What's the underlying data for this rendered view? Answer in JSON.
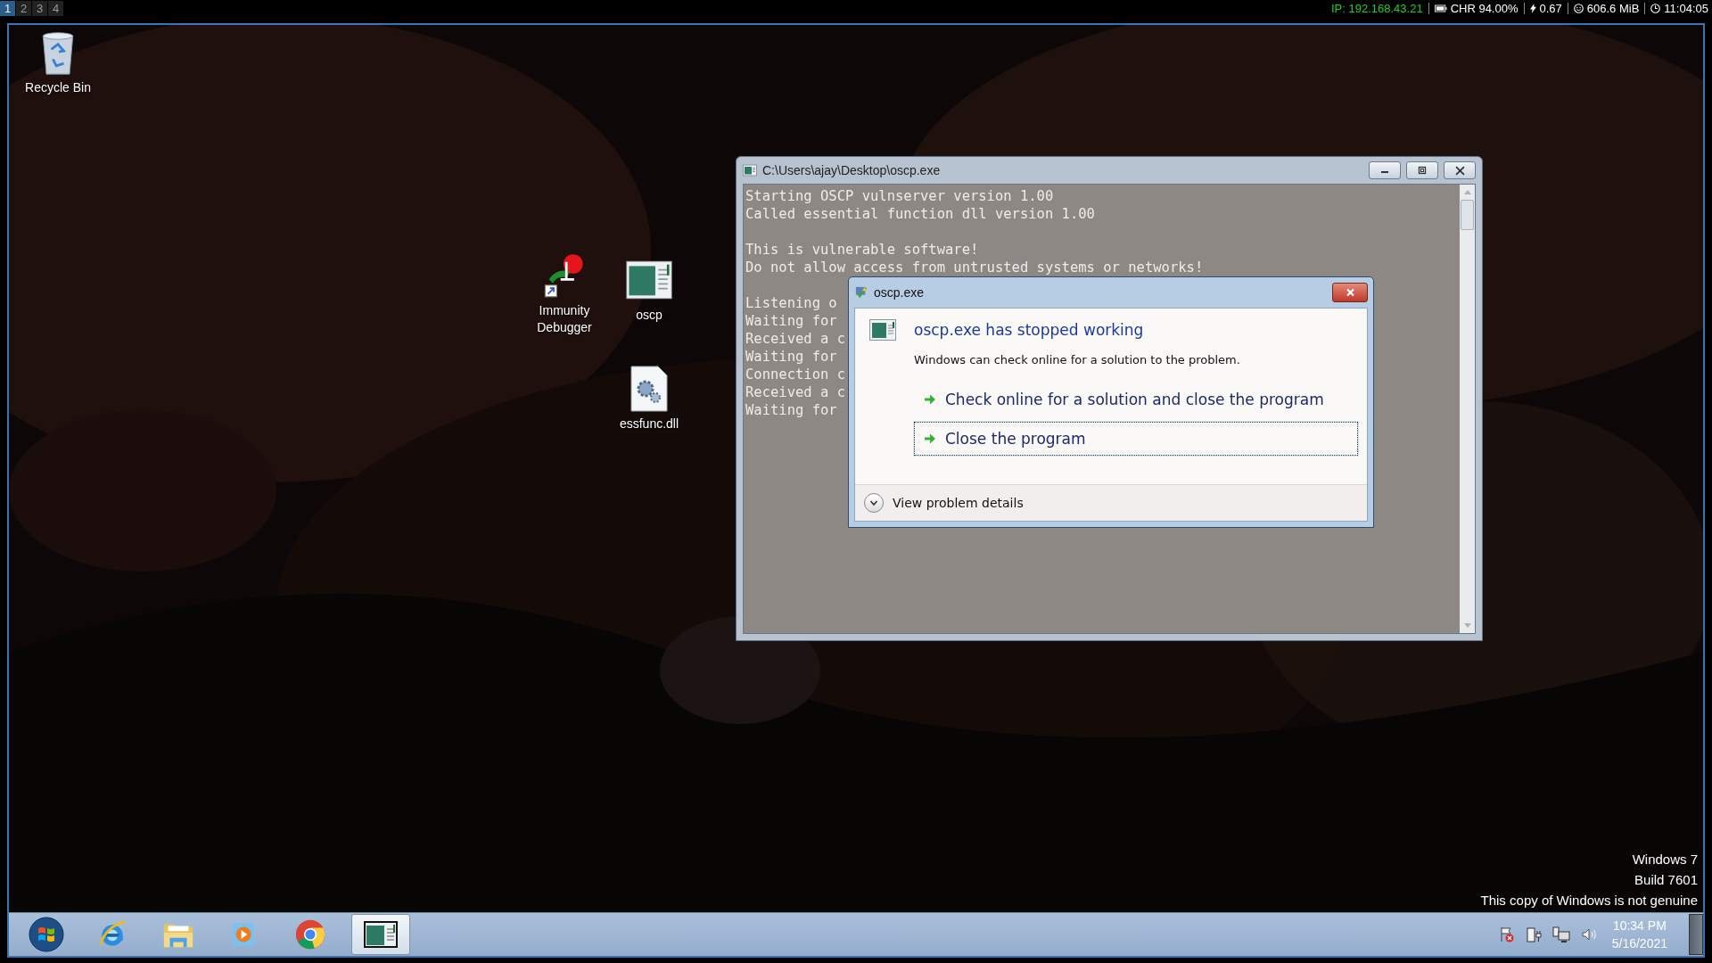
{
  "workspaces": [
    {
      "label": "1",
      "selected": true
    },
    {
      "label": "2",
      "selected": false
    },
    {
      "label": "3",
      "selected": false
    },
    {
      "label": "4",
      "selected": false
    }
  ],
  "status_bar": {
    "ip": "IP: 192.168.43.21",
    "battery": "CHR 94.00%",
    "load": "0.67",
    "memory": "606.6 MiB",
    "time": "11:04:05"
  },
  "desktop_icons": [
    {
      "kind": "recycle-bin",
      "label": "Recycle Bin"
    },
    {
      "kind": "debugger",
      "label": "Immunity Debugger"
    },
    {
      "kind": "program",
      "label": "oscp"
    },
    {
      "kind": "dll",
      "label": "essfunc.dll"
    }
  ],
  "console_window": {
    "title": "C:\\Users\\ajay\\Desktop\\oscp.exe",
    "blocks": [
      {
        "lines": [
          "Starting OSCP vulnserver version 1.00",
          "Called essential function dll version 1.00"
        ]
      },
      {
        "lines": [
          "This is vulnerable software!",
          "Do not allow access from untrusted systems or networks!"
        ]
      },
      {
        "lines": [
          "Listening o",
          "Waiting for",
          "Received a c",
          "Waiting for",
          "Connection c",
          "Received a c",
          "Waiting for"
        ]
      }
    ]
  },
  "error_dialog": {
    "title": "oscp.exe",
    "heading": "oscp.exe has stopped working",
    "message": "Windows can check online for a solution to the problem.",
    "options": [
      {
        "label": "Check online for a solution and close the program",
        "selected": false
      },
      {
        "label": "Close the program",
        "selected": true
      }
    ],
    "details_link": "View problem details"
  },
  "desktop_notice": [
    "Windows 7",
    "Build 7601",
    "This copy of Windows is not genuine"
  ],
  "taskbar": {
    "items": [
      {
        "kind": "start",
        "active": false
      },
      {
        "kind": "browser-e",
        "active": false
      },
      {
        "kind": "folder",
        "active": false
      },
      {
        "kind": "media",
        "active": false
      },
      {
        "kind": "chrome",
        "active": false
      },
      {
        "kind": "console",
        "active": true
      }
    ],
    "clock": {
      "time": "10:34 PM",
      "date": "5/16/2021"
    }
  }
}
